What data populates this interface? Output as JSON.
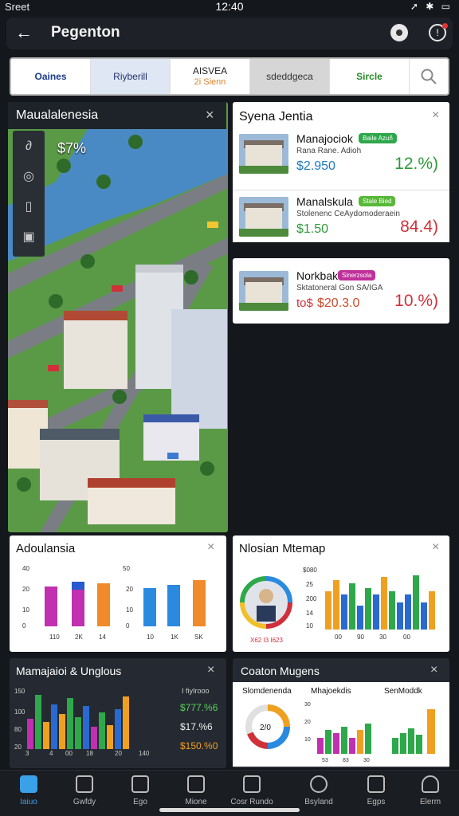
{
  "status_bar": {
    "carrier": "Sreet",
    "time": "12:40",
    "right_icons": "➚ ✱ ▭"
  },
  "app_bar": {
    "back_icon": "←",
    "title": "Pegenton",
    "pin_icon": "location-pin-icon",
    "alert_icon": "!"
  },
  "tabs": [
    {
      "label": "Oaines"
    },
    {
      "label": "Riyberill"
    },
    {
      "label": "AISVEA",
      "sub": "2i Sienn"
    },
    {
      "label": "sdeddgeca"
    },
    {
      "label": "Sircle"
    }
  ],
  "map": {
    "title": "Maualalenesia",
    "close": "×",
    "percent": "$7%"
  },
  "listings": {
    "title": "Syena Jentia",
    "close": "×",
    "items": [
      {
        "name": "Manajociok",
        "badge": "Baile Azuñ",
        "badge_color": "#2ea84a",
        "sub": "Rana Rane. Adioh",
        "price": "$2.950",
        "change": "12.%)",
        "change_color": "#2e9a3a"
      },
      {
        "name": "Manalskula",
        "badge": "Stale Bied",
        "badge_color": "#58b838",
        "sub": "Stolenenc CeAydomoderaein",
        "price": "$1.50",
        "change": "84.4)",
        "change_color": "#d0303a"
      },
      {
        "name": "Norkbak",
        "badge": "Sinerzsola",
        "badge_color": "#c0309a",
        "sub": "Sktatoneral Gon SA/IGA",
        "price": "$20.3.0",
        "price_prefix": "to$",
        "change": "10.%)",
        "change_color": "#d0303a"
      }
    ]
  },
  "chart1": {
    "title": "Adoulansia",
    "close": "×",
    "y_left": [
      "40",
      "20",
      "10",
      "0"
    ],
    "x_left": [
      "110",
      "2K",
      "14"
    ],
    "y_right": [
      "50",
      "20",
      "10",
      "0"
    ],
    "x_right": [
      "10",
      "1K",
      "SK"
    ]
  },
  "chart2": {
    "title": "Nlosian Mtemap",
    "close": "×",
    "pie_values": "X62 I3 I623",
    "y": [
      "$080",
      "25",
      "200",
      "14",
      "10"
    ],
    "x": [
      "00",
      "90",
      "30",
      "00"
    ]
  },
  "chart3": {
    "title": "Mamajaioi & Unglous",
    "close": "×",
    "y": [
      "150",
      "100",
      "80",
      "20"
    ],
    "x": [
      "3",
      "4",
      "00",
      "18",
      "20",
      "140"
    ],
    "legend_header": "I fiyIrooo",
    "values": [
      "$777.%6",
      "$17.%6",
      "$150.%0"
    ]
  },
  "chart4": {
    "title": "Coaton Mugens",
    "close": "×",
    "sub1": "Slomdenenda",
    "sub2": "Mhajoekdis",
    "sub3": "SenModdk",
    "donut_value": "2/0",
    "x": [
      "53",
      "83",
      "30"
    ],
    "y": [
      "10",
      "20",
      "30"
    ]
  },
  "bottom_nav": [
    {
      "label": "Iaiuo"
    },
    {
      "label": "Gwfdy"
    },
    {
      "label": "Ego"
    },
    {
      "label": "Mione"
    },
    {
      "label": "Cosr Rundo"
    },
    {
      "label": "Bsyland"
    },
    {
      "label": "Egps"
    },
    {
      "label": "Elerm"
    }
  ],
  "colors": {
    "green": "#2ea84a",
    "red": "#d0303a",
    "blue": "#1a7ac0",
    "dark": "#14171c"
  }
}
